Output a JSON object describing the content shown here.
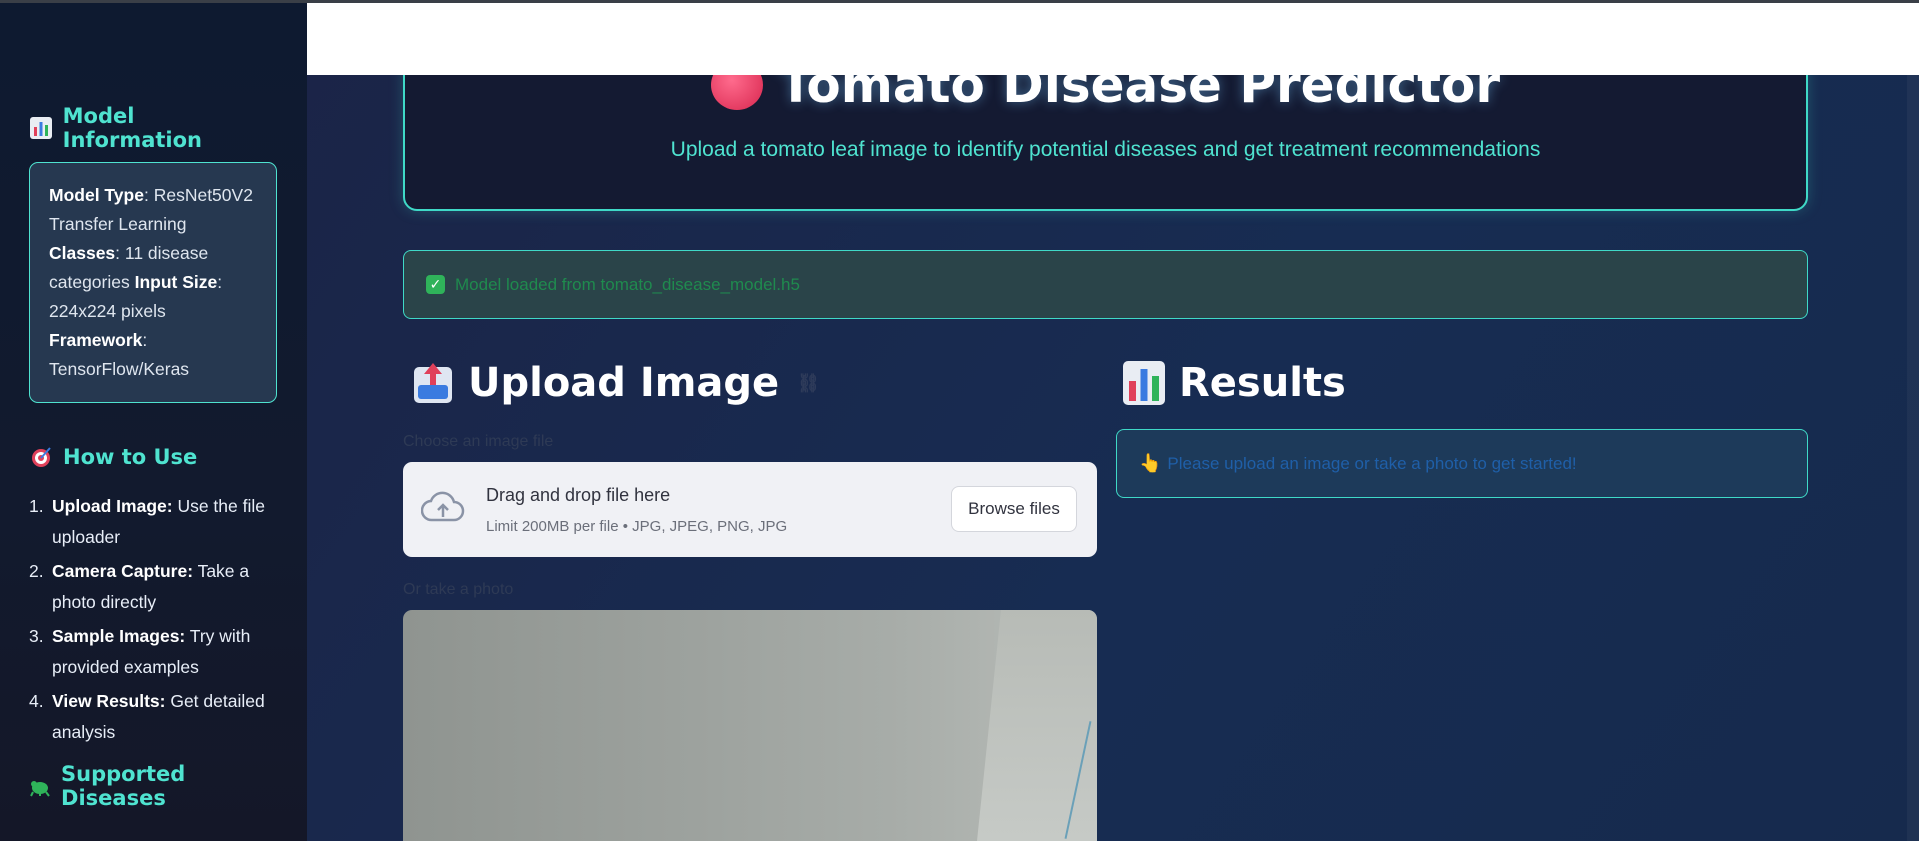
{
  "sidebar": {
    "model_info": {
      "heading": "Model Information",
      "icon": "bar-chart-icon",
      "lines": [
        {
          "label": "Model Type",
          "value": "ResNet50V2"
        },
        {
          "text": "Transfer Learning"
        },
        {
          "label": "Classes",
          "value": "11 disease"
        },
        {
          "text": "categories",
          "label2": "Input Size",
          "sep": ":"
        },
        {
          "text": "224x224 pixels"
        },
        {
          "label": "Framework",
          "sep": ":"
        },
        {
          "text": "TensorFlow/Keras"
        }
      ]
    },
    "how_to_use": {
      "heading": "How to Use",
      "icon": "target-icon",
      "steps": [
        {
          "num": "1.",
          "bold": "Upload Image:",
          "text": " Use the file uploader"
        },
        {
          "num": "2.",
          "bold": "Camera Capture:",
          "text": " Take a photo directly"
        },
        {
          "num": "3.",
          "bold": "Sample Images:",
          "text": " Try with provided examples"
        },
        {
          "num": "4.",
          "bold": "View Results:",
          "text": " Get detailed analysis"
        }
      ]
    },
    "supported_diseases": {
      "heading": "Supported Diseases",
      "icon": "bug-icon"
    }
  },
  "main": {
    "title": "Tomato Disease Predictor",
    "subtitle": "Upload a tomato leaf image to identify potential diseases and get treatment recommendations",
    "success_message": "Model loaded from tomato_disease_model.h5",
    "upload": {
      "heading": "Upload Image",
      "file_label": "Choose an image file",
      "dropzone_title": "Drag and drop file here",
      "dropzone_hint": "Limit 200MB per file • JPG, JPEG, PNG, JPG",
      "browse_button": "Browse files",
      "photo_label": "Or take a photo"
    },
    "results": {
      "heading": "Results",
      "info_message": "Please upload an image or take a photo to get started!"
    }
  },
  "colors": {
    "accent": "#4fe3d0",
    "sidebar_bg": "#0e1a30",
    "main_bg": "#172c52",
    "success_text": "#1f8a4e",
    "info_text": "#1f5fa8"
  }
}
